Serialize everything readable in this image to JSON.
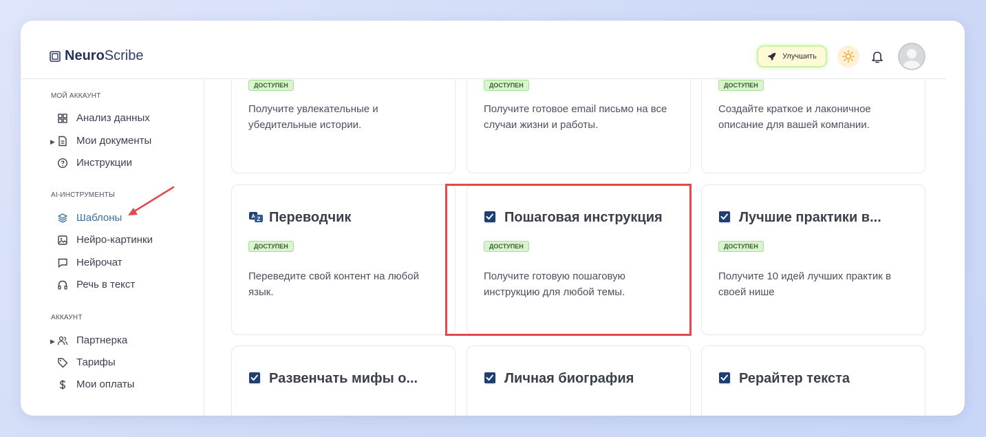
{
  "logo": {
    "bold": "Neuro",
    "light": "Scribe"
  },
  "header": {
    "upgrade_label": "Улучшить"
  },
  "sidebar": {
    "sections": [
      {
        "title": "МОЙ АККАУНТ"
      },
      {
        "title": "AI-ИНСТРУМЕНТЫ"
      },
      {
        "title": "АККАУНТ"
      }
    ],
    "items": [
      {
        "label": "Анализ данных",
        "icon": "grid-icon"
      },
      {
        "label": "Мои документы",
        "icon": "document-icon"
      },
      {
        "label": "Инструкции",
        "icon": "help-circle-icon"
      },
      {
        "label": "Шаблоны",
        "icon": "layers-icon",
        "active": true
      },
      {
        "label": "Нейро-картинки",
        "icon": "image-icon"
      },
      {
        "label": "Нейрочат",
        "icon": "chat-icon"
      },
      {
        "label": "Речь в текст",
        "icon": "headphones-icon"
      },
      {
        "label": "Партнерка",
        "icon": "users-icon"
      },
      {
        "label": "Тарифы",
        "icon": "tag-icon"
      },
      {
        "label": "Мои оплаты",
        "icon": "dollar-icon"
      }
    ]
  },
  "cards": [
    {
      "title": "",
      "badge": "ДОСТУПЕН",
      "desc": "Получите увлекательные и убедительные истории."
    },
    {
      "title": "",
      "badge": "ДОСТУПЕН",
      "desc": "Получите готовое email письмо на все случаи жизни и работы."
    },
    {
      "title": "",
      "badge": "ДОСТУПЕН",
      "desc": "Создайте краткое и лаконичное описание для вашей компании."
    },
    {
      "title": "Переводчик",
      "badge": "ДОСТУПЕН",
      "desc": "Переведите свой контент на любой язык.",
      "icon": "translate-icon"
    },
    {
      "title": "Пошаговая инструкция",
      "badge": "ДОСТУПЕН",
      "desc": "Получите готовую пошаговую инструкцию для любой темы.",
      "icon": "checkbox-icon"
    },
    {
      "title": "Лучшие практики в...",
      "badge": "ДОСТУПЕН",
      "desc": "Получите 10 идей лучших практик в своей нише",
      "icon": "checkbox-icon"
    },
    {
      "title": "Развенчать мифы о...",
      "icon": "checkbox-icon"
    },
    {
      "title": "Личная биография",
      "icon": "checkbox-icon"
    },
    {
      "title": "Рерайтер текста",
      "icon": "checkbox-icon"
    }
  ]
}
